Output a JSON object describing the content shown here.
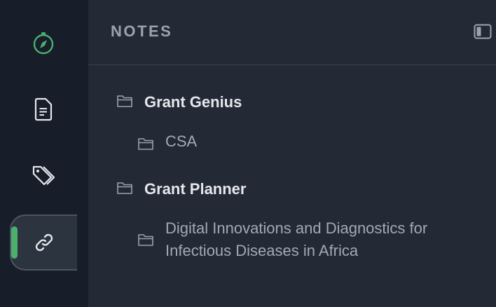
{
  "sidebar": {
    "items": [
      {
        "name": "explore",
        "icon": "compass-icon",
        "active": false
      },
      {
        "name": "notes",
        "icon": "document-icon",
        "active": false
      },
      {
        "name": "tags",
        "icon": "tags-icon",
        "active": false
      },
      {
        "name": "links",
        "icon": "link-icon",
        "active": true
      }
    ]
  },
  "notes_panel": {
    "title": "NOTES",
    "toggle_icon": "sidebar-toggle-icon",
    "tree": [
      {
        "label": "Grant Genius",
        "icon": "folder-icon",
        "children": [
          {
            "label": "CSA",
            "icon": "folder-icon"
          }
        ]
      },
      {
        "label": "Grant Planner",
        "icon": "folder-icon",
        "children": [
          {
            "label_line1": "Digital Innovations and Diagnostics for",
            "label_line2": "Infectious Diseases in Africa",
            "icon": "folder-icon"
          }
        ]
      }
    ]
  },
  "colors": {
    "rail_bg": "#171d29",
    "panel_bg": "#232a36",
    "accent_green": "#4caf6e",
    "title_gray": "#9ba3af"
  }
}
